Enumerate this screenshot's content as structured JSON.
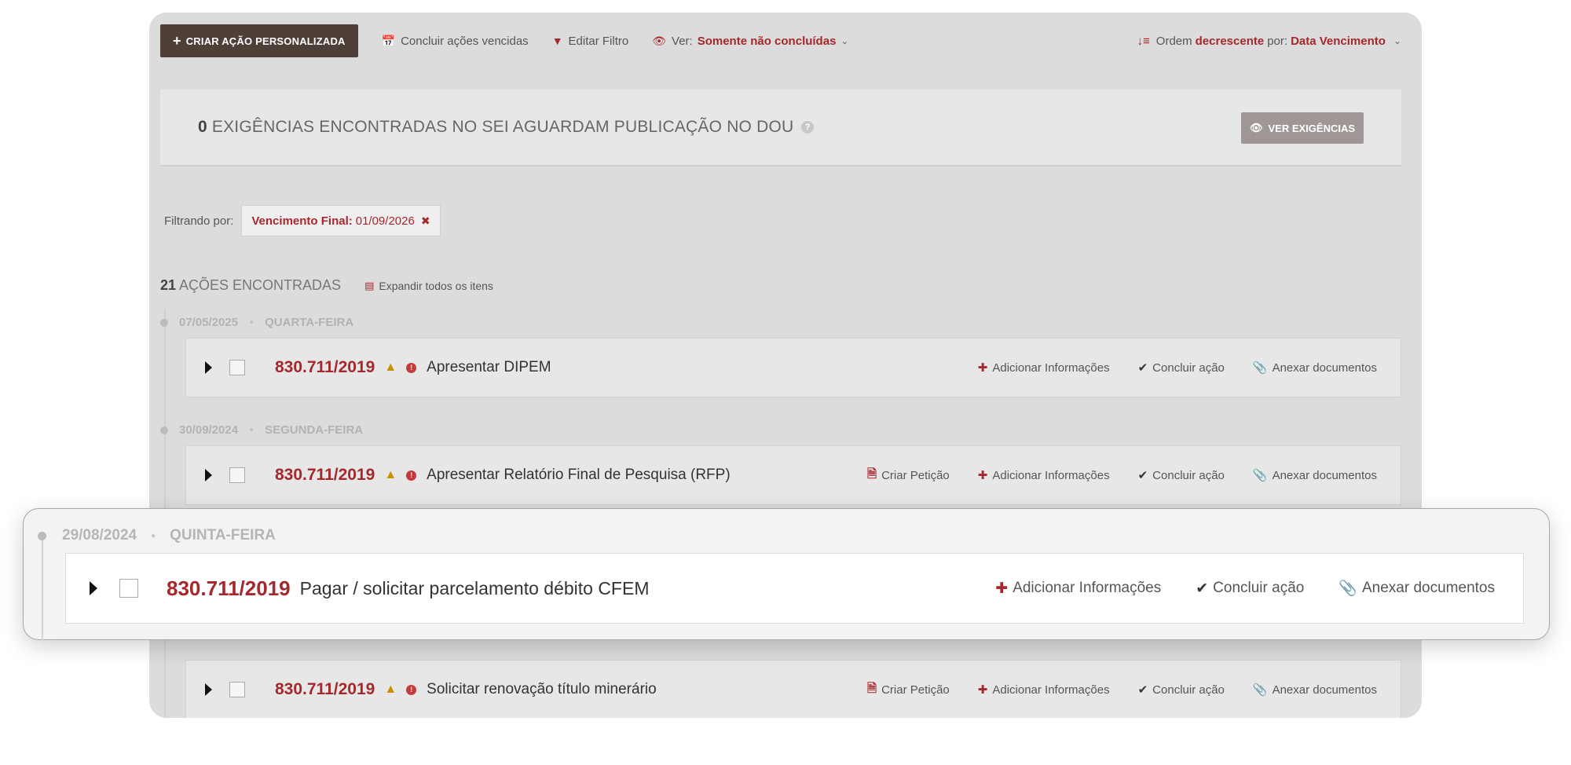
{
  "toolbar": {
    "create_label": "CRIAR AÇÃO PERSONALIZADA",
    "conclude_overdue": "Concluir ações vencidas",
    "edit_filter": "Editar Filtro",
    "view_label": "Ver:",
    "view_value": "Somente não concluídas",
    "order_label": "Ordem",
    "order_direction": "decrescente",
    "order_by_label": "por:",
    "order_field": "Data Vencimento"
  },
  "exigencias": {
    "count": "0",
    "text": "EXIGÊNCIAS ENCONTRADAS NO SEI AGUARDAM PUBLICAÇÃO NO DOU",
    "button": "VER EXIGÊNCIAS"
  },
  "filter": {
    "label": "Filtrando por:",
    "chip_key": "Vencimento Final:",
    "chip_value": "01/09/2026"
  },
  "results": {
    "count": "21",
    "text": "AÇÕES ENCONTRADAS",
    "expand_all": "Expandir todos os itens"
  },
  "actions_labels": {
    "create_petition": "Criar Petição",
    "add_info": "Adicionar Informações",
    "conclude": "Concluir ação",
    "attach": "Anexar documentos"
  },
  "groups": [
    {
      "date": "07/05/2025",
      "weekday": "QUARTA-FEIRA",
      "process": "830.711/2019",
      "title": "Apresentar DIPEM"
    },
    {
      "date": "30/09/2024",
      "weekday": "SEGUNDA-FEIRA",
      "process": "830.711/2019",
      "title": "Apresentar Relatório Final de Pesquisa (RFP)"
    },
    {
      "date": "29/08/2024",
      "weekday": "QUINTA-FEIRA",
      "process": "830.711/2019",
      "title": "Pagar / solicitar parcelamento débito CFEM"
    },
    {
      "process": "830.711/2019",
      "title": "Solicitar renovação título minerário"
    }
  ],
  "colors": {
    "accent": "#a5282c",
    "dark_button": "#4e4039",
    "panel": "#dcdcdc"
  }
}
